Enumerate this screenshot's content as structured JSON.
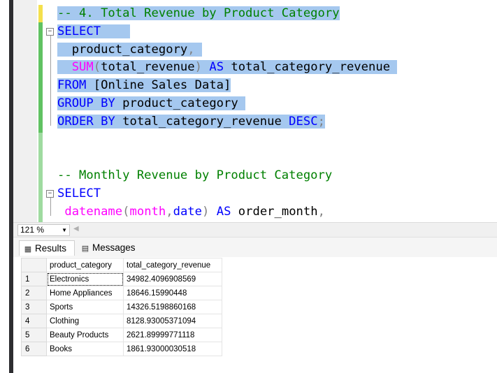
{
  "editor": {
    "lines": [
      {
        "parts": [
          {
            "t": "-- 4. Total Revenue by Product Category",
            "c": "cm"
          }
        ],
        "selected": true
      },
      {
        "parts": [
          {
            "t": "SELECT",
            "c": "kw"
          },
          {
            "t": "    ",
            "c": "tx"
          }
        ],
        "selected": true,
        "fold": "−"
      },
      {
        "parts": [
          {
            "t": "  product_category",
            "c": "tx"
          },
          {
            "t": ", ",
            "c": "gy"
          }
        ],
        "selected": true
      },
      {
        "parts": [
          {
            "t": "  ",
            "c": "tx"
          },
          {
            "t": "SUM",
            "c": "fn"
          },
          {
            "t": "(",
            "c": "gy"
          },
          {
            "t": "total_revenue",
            "c": "tx"
          },
          {
            "t": ") ",
            "c": "gy"
          },
          {
            "t": "AS",
            "c": "kw"
          },
          {
            "t": " total_category_revenue ",
            "c": "tx"
          }
        ],
        "selected": true
      },
      {
        "parts": [
          {
            "t": "FROM",
            "c": "kw"
          },
          {
            "t": " [Online Sales Data]",
            "c": "tx"
          }
        ],
        "selected": true
      },
      {
        "parts": [
          {
            "t": "GROUP BY",
            "c": "kw"
          },
          {
            "t": " product_category ",
            "c": "tx"
          }
        ],
        "selected": true
      },
      {
        "parts": [
          {
            "t": "ORDER BY",
            "c": "kw"
          },
          {
            "t": " total_category_revenue ",
            "c": "tx"
          },
          {
            "t": "DESC",
            "c": "kw"
          },
          {
            "t": ";",
            "c": "gy"
          }
        ],
        "selected": true
      },
      {
        "parts": [
          {
            "t": "",
            "c": "tx"
          }
        ],
        "selected": false
      },
      {
        "parts": [
          {
            "t": "",
            "c": "tx"
          }
        ],
        "selected": false
      },
      {
        "parts": [
          {
            "t": "-- Monthly Revenue by Product Category",
            "c": "cm"
          }
        ],
        "selected": false
      },
      {
        "parts": [
          {
            "t": "SELECT",
            "c": "kw"
          }
        ],
        "selected": false,
        "fold": "−"
      },
      {
        "parts": [
          {
            "t": " datename",
            "c": "fn"
          },
          {
            "t": "(",
            "c": "gy"
          },
          {
            "t": "month",
            "c": "fn"
          },
          {
            "t": ",",
            "c": "gy"
          },
          {
            "t": "date",
            "c": "kw"
          },
          {
            "t": ") ",
            "c": "gy"
          },
          {
            "t": "AS",
            "c": "kw"
          },
          {
            "t": " order_month",
            "c": "tx"
          },
          {
            "t": ",",
            "c": "gy"
          }
        ],
        "selected": false
      }
    ]
  },
  "zoom": {
    "value": "121 %"
  },
  "tabs": {
    "results": "Results",
    "messages": "Messages"
  },
  "grid": {
    "headers": [
      "product_category",
      "total_category_revenue"
    ],
    "rows": [
      {
        "n": "1",
        "category": "Electronics",
        "revenue": "34982.4096908569"
      },
      {
        "n": "2",
        "category": "Home Appliances",
        "revenue": "18646.15990448"
      },
      {
        "n": "3",
        "category": "Sports",
        "revenue": "14326.5198860168"
      },
      {
        "n": "4",
        "category": "Clothing",
        "revenue": "8128.93005371094"
      },
      {
        "n": "5",
        "category": "Beauty Products",
        "revenue": "2621.89999771118"
      },
      {
        "n": "6",
        "category": "Books",
        "revenue": "1861.93000030518"
      }
    ]
  },
  "colors": {
    "selection": "#a5c8ef",
    "keyword": "#0000ff",
    "function": "#ff00ff",
    "comment": "#008000"
  }
}
